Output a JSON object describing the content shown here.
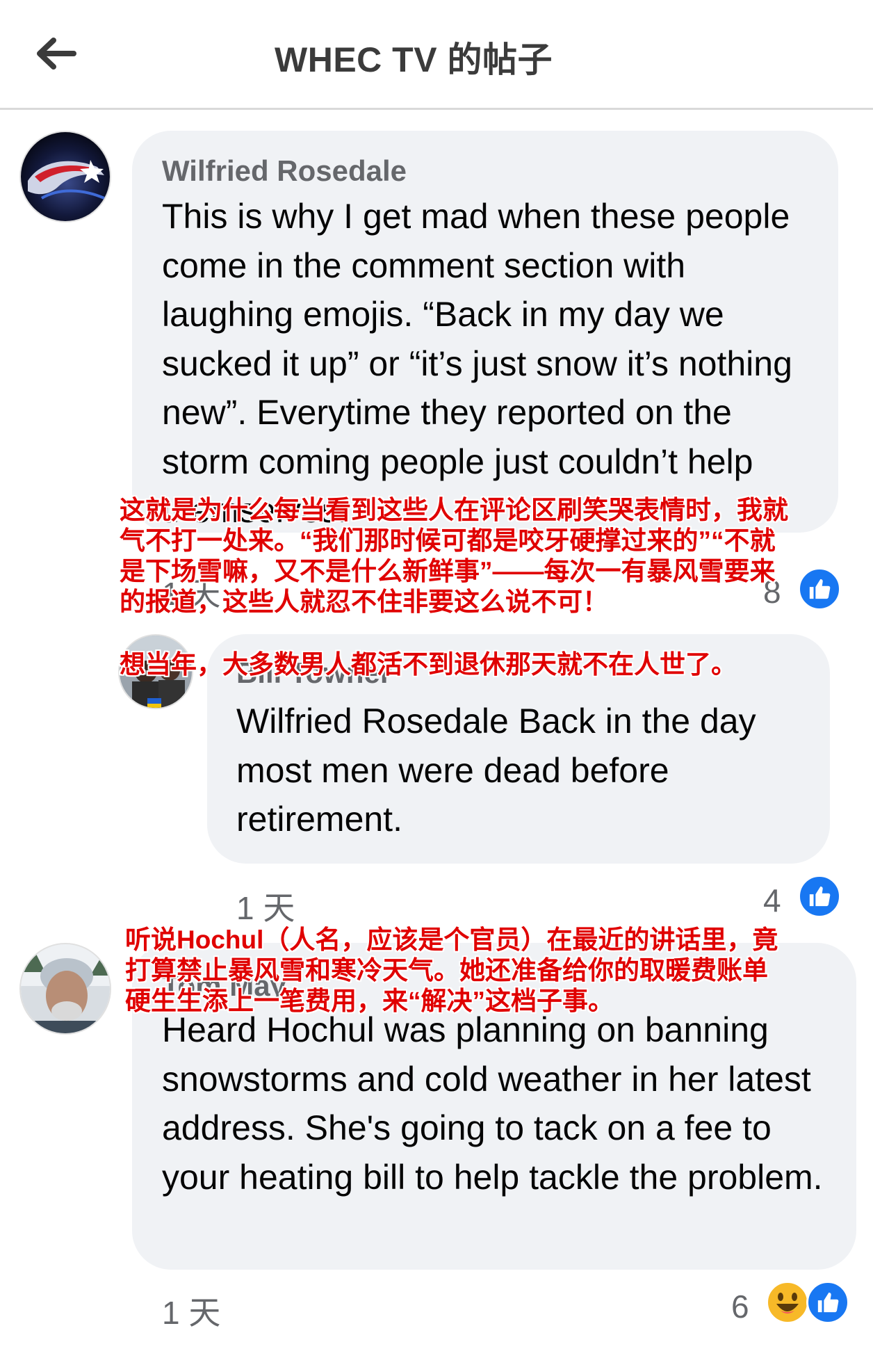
{
  "header": {
    "title": "WHEC TV 的帖子"
  },
  "comments": [
    {
      "author": "Wilfried Rosedale",
      "text": "This is why I get mad when these people come in the comment section with laughing emojis. “Back in my day we sucked it up” or “it’s just snow it’s nothing new”. Everytime they reported on the storm coming people just couldn’t help themselves.",
      "time": "1 天",
      "reactions": 8,
      "reaction_icons": [
        "like-icon"
      ],
      "translation": "这就是为什么每当看到这些人在评论区刷笑哭表情时，我就气不打一处来。“我们那时候可都是咬牙硬撑过来的”“不就是下场雪嘛，又不是什么新鲜事”——每次一有暴风雪要来的报道，这些人就忍不住非要这么说不可！"
    },
    {
      "author": "Bill Towner",
      "text": "Wilfried Rosedale Back in the day most men were dead before retirement.",
      "time": "1 天",
      "reactions": 4,
      "reaction_icons": [
        "like-icon"
      ],
      "translation": "想当年，大多数男人都活不到退休那天就不在人世了。"
    },
    {
      "author": "Tom May",
      "text": "Heard Hochul was planning on banning snowstorms and cold weather in her latest address. She's going to tack on a fee to your heating bill to help tackle the problem.",
      "time": "1 天",
      "reactions": 6,
      "reaction_icons": [
        "haha-icon",
        "like-icon"
      ],
      "translation": "听说Hochul（人名，应该是个官员）在最近的讲话里，竟打算禁止暴风雪和寒冷天气。她还准备给你的取暖费账单硬生生添上一笔费用，来“解决”这档子事。"
    }
  ],
  "colors": {
    "bubble": "#f0f2f5",
    "like": "#1877f2",
    "haha": "#f7b928",
    "overlay": "#e00000"
  }
}
